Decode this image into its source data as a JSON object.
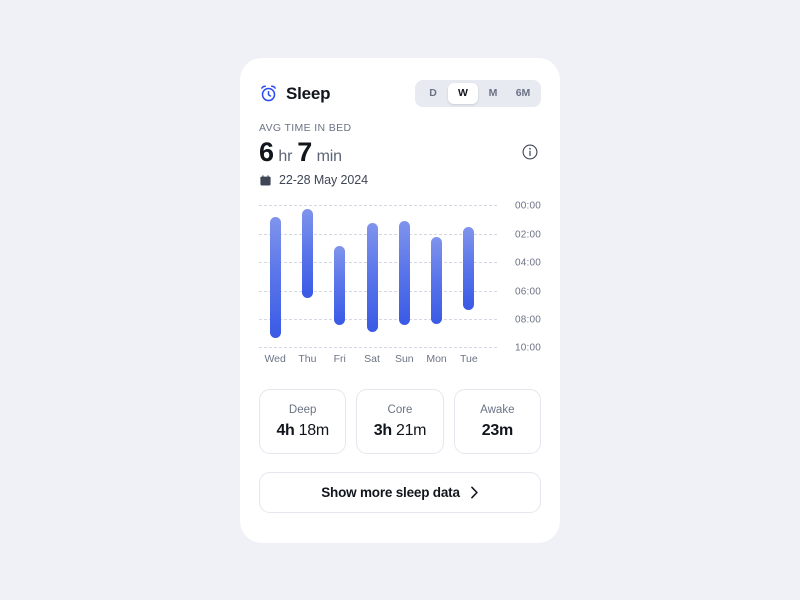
{
  "card": {
    "header": {
      "icon": "alarm-clock-icon",
      "title": "Sleep",
      "range_options": [
        {
          "label": "D",
          "selected": false
        },
        {
          "label": "W",
          "selected": true
        },
        {
          "label": "M",
          "selected": false
        },
        {
          "label": "6M",
          "selected": false
        }
      ]
    },
    "summary": {
      "label": "AVG TIME IN BED",
      "hours_value": "6",
      "hours_unit": "hr",
      "minutes_value": "7",
      "minutes_unit": "min",
      "info_icon": "info-circle-icon",
      "calendar_icon": "calendar-icon",
      "date_range": "22-28 May 2024"
    },
    "stats": [
      {
        "label": "Deep",
        "value_num": "4h",
        "value_rest": " 18m"
      },
      {
        "label": "Core",
        "value_num": "3h",
        "value_rest": " 21m"
      },
      {
        "label": "Awake",
        "value_num": "23m",
        "value_rest": ""
      }
    ],
    "footer": {
      "label": "Show more sleep data",
      "icon": "chevron-right-icon"
    }
  },
  "colors": {
    "page_bg": "#eff1f6",
    "card_bg": "#ffffff",
    "accent_blue": "#2a4bf0",
    "bar_top": "#8094ec",
    "bar_bottom": "#3a5ae6",
    "text_primary": "#11151c",
    "text_muted": "#6b7385",
    "grid": "#d3d8e3",
    "border": "#e4e7ee",
    "segment_bg": "#e7eaf1"
  },
  "chart_data": {
    "type": "bar",
    "orientation": "vertical-range",
    "title": "",
    "xlabel": "",
    "ylabel": "",
    "categories": [
      "Wed",
      "Thu",
      "Fri",
      "Sat",
      "Sun",
      "Mon",
      "Tue"
    ],
    "y_tick_labels": [
      "00:00",
      "02:00",
      "04:00",
      "06:00",
      "08:00",
      "10:00"
    ],
    "y_tick_hours": [
      0,
      2,
      4,
      6,
      8,
      10
    ],
    "ylim": [
      0,
      10
    ],
    "y_axis_inverted": true,
    "y_axis_position": "right",
    "grid": true,
    "grid_style": "dashed",
    "legend": "none",
    "series": [
      {
        "name": "Time in bed",
        "units": "hours (clock time)",
        "bars": [
          {
            "category": "Wed",
            "start": 0.85,
            "end": 9.35,
            "duration_hours": 8.5
          },
          {
            "category": "Thu",
            "start": 0.28,
            "end": 6.5,
            "duration_hours": 6.22
          },
          {
            "category": "Fri",
            "start": 2.85,
            "end": 8.45,
            "duration_hours": 5.6
          },
          {
            "category": "Sat",
            "start": 1.27,
            "end": 8.95,
            "duration_hours": 7.68
          },
          {
            "category": "Sun",
            "start": 1.12,
            "end": 8.45,
            "duration_hours": 7.33
          },
          {
            "category": "Mon",
            "start": 2.25,
            "end": 8.38,
            "duration_hours": 6.13
          },
          {
            "category": "Tue",
            "start": 1.55,
            "end": 7.4,
            "duration_hours": 5.85
          }
        ]
      }
    ]
  }
}
